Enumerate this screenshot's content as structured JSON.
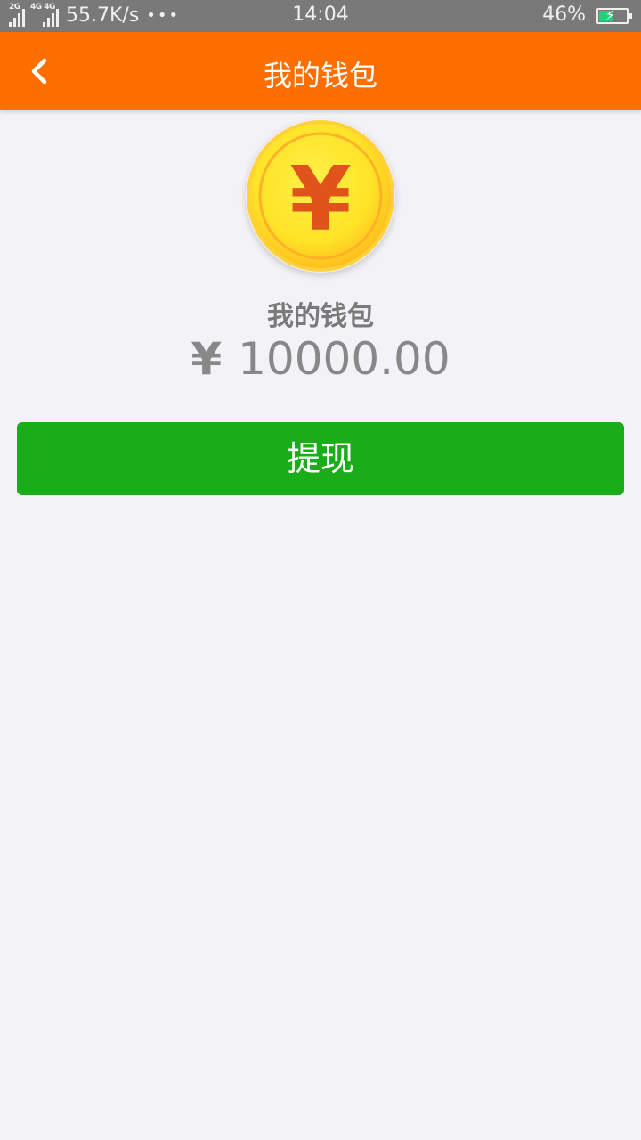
{
  "status_bar": {
    "net1_label": "2G",
    "net2_label": "4G 4G",
    "speed": "55.7K/s",
    "more": "•••",
    "time": "14:04",
    "battery": "46%",
    "battery_level": 0.46
  },
  "header": {
    "title": "我的钱包",
    "back_icon": "chevron-left-icon"
  },
  "wallet": {
    "icon": "yen-coin-icon",
    "label": "我的钱包",
    "currency_symbol": "¥",
    "amount": "10000.00"
  },
  "actions": {
    "withdraw_label": "提现"
  },
  "colors": {
    "app_bar": "#ff6f00",
    "button": "#1aad19",
    "background": "#f3f3f7",
    "coin": "#ffe326",
    "coin_symbol": "#e0531a"
  }
}
